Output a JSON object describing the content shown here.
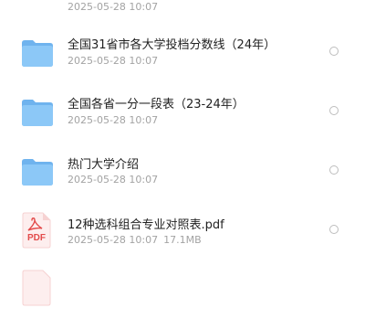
{
  "files": [
    {
      "name": "",
      "date": "2025-05-28 10:07",
      "size": "",
      "type": "folder",
      "icon": "folder-icon"
    },
    {
      "name": "全国31省市各大学投档分数线（24年）",
      "date": "2025-05-28 10:07",
      "size": "",
      "type": "folder",
      "icon": "folder-icon"
    },
    {
      "name": "全国各省一分一段表（23-24年）",
      "date": "2025-05-28 10:07",
      "size": "",
      "type": "folder",
      "icon": "folder-icon"
    },
    {
      "name": "热门大学介绍",
      "date": "2025-05-28 10:07",
      "size": "",
      "type": "folder",
      "icon": "folder-icon"
    },
    {
      "name": "12种选科组合专业对照表.pdf",
      "date": "2025-05-28 10:07",
      "size": "17.1MB",
      "type": "pdf",
      "icon": "pdf-file-icon",
      "badge": "PDF"
    },
    {
      "name": "",
      "date": "",
      "size": "",
      "type": "pdf",
      "icon": "pdf-file-icon",
      "badge": ""
    }
  ],
  "colors": {
    "folder": "#8cc8f7",
    "folder_dark": "#6fb3ee",
    "pdf": "#e34b4b"
  }
}
